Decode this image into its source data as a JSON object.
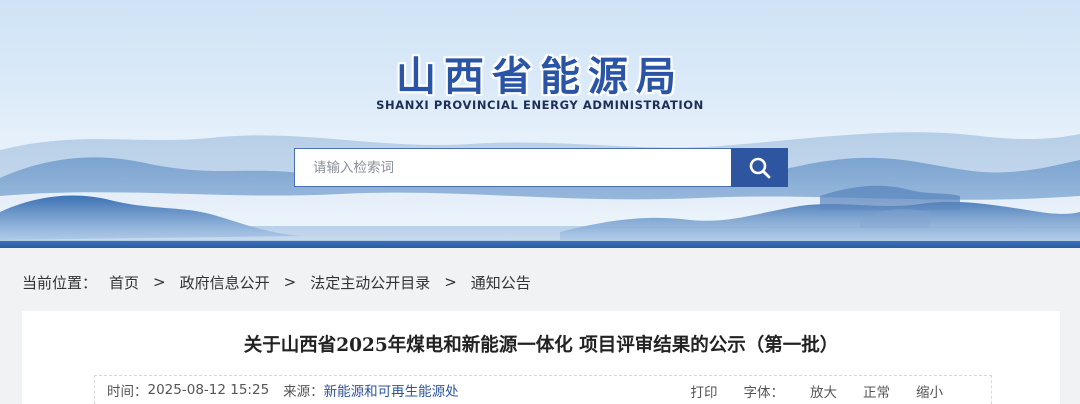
{
  "header": {
    "title": "山西省能源局",
    "subtitle": "SHANXI PROVINCIAL ENERGY ADMINISTRATION"
  },
  "search": {
    "placeholder": "请输入检索词",
    "value": "",
    "button_icon": "search-icon"
  },
  "breadcrumb": {
    "lead": "当前位置：",
    "items": [
      "首页",
      "政府信息公开",
      "法定主动公开目录",
      "通知公告"
    ],
    "separator": ">"
  },
  "article": {
    "title": "关于山西省2025年煤电和新能源一体化 项目评审结果的公示（第一批）",
    "meta": {
      "time_label": "时间：",
      "time_value": "2025-08-12 15:25",
      "source_label": "来源：",
      "source_value": "新能源和可再生能源处",
      "print": "打印",
      "font_label": "字体：",
      "font_large": "放大",
      "font_normal": "正常",
      "font_small": "缩小"
    }
  },
  "colors": {
    "brand_blue": "#2d55a0",
    "banner_sky": "#d9e8f7",
    "page_bg": "#f1f2f4"
  }
}
